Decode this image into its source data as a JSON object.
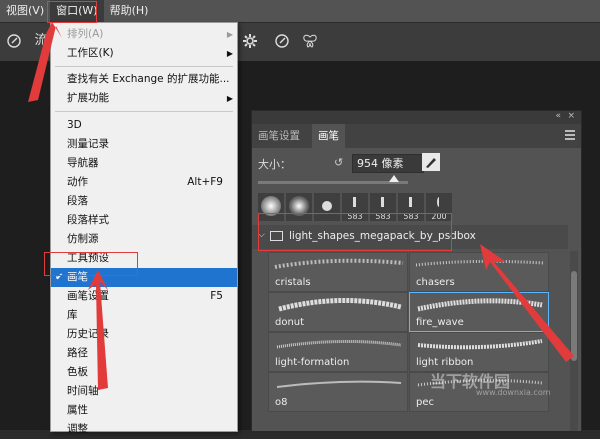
{
  "menubar": {
    "items": [
      "视图(V)",
      "窗口(W)",
      "帮助(H)"
    ]
  },
  "toolbar": {
    "partial_label": "流"
  },
  "dropdown": {
    "items": [
      {
        "label": "排列(A)",
        "shortcut": "",
        "submenu": true,
        "disabled": true
      },
      {
        "label": "工作区(K)",
        "shortcut": "",
        "submenu": true
      },
      {
        "label": "查找有关 Exchange 的扩展功能...",
        "shortcut": ""
      },
      {
        "label": "扩展功能",
        "shortcut": "",
        "submenu": true
      },
      {
        "label": "3D",
        "shortcut": ""
      },
      {
        "label": "测量记录",
        "shortcut": ""
      },
      {
        "label": "导航器",
        "shortcut": ""
      },
      {
        "label": "动作",
        "shortcut": "Alt+F9"
      },
      {
        "label": "段落",
        "shortcut": ""
      },
      {
        "label": "段落样式",
        "shortcut": ""
      },
      {
        "label": "仿制源",
        "shortcut": ""
      },
      {
        "label": "工具预设",
        "shortcut": ""
      },
      {
        "label": "画笔",
        "shortcut": "",
        "checked": true,
        "selected": true
      },
      {
        "label": "画笔设置",
        "shortcut": "F5"
      },
      {
        "label": "库",
        "shortcut": ""
      },
      {
        "label": "历史记录",
        "shortcut": ""
      },
      {
        "label": "路径",
        "shortcut": ""
      },
      {
        "label": "色板",
        "shortcut": ""
      },
      {
        "label": "时间轴",
        "shortcut": ""
      },
      {
        "label": "属性",
        "shortcut": ""
      },
      {
        "label": "调整",
        "shortcut": ""
      }
    ]
  },
  "panel": {
    "tabs": [
      "画笔设置",
      "画笔"
    ],
    "size_label": "大小：",
    "size_value": "954 像素",
    "presets": [
      "",
      "",
      "",
      "583",
      "583",
      "583",
      "200"
    ],
    "folder_name": "light_shapes_megapack_by_psdbox",
    "brushes": [
      "cristals",
      "chasers",
      "donut",
      "fire_wave",
      "light-formation",
      "light ribbon",
      "o8",
      "pec"
    ]
  },
  "watermark": {
    "text": "当下软件园",
    "sub": "www.downxia.com"
  },
  "colors": {
    "highlight": "#e23b3b",
    "accent": "#1f74cf"
  }
}
